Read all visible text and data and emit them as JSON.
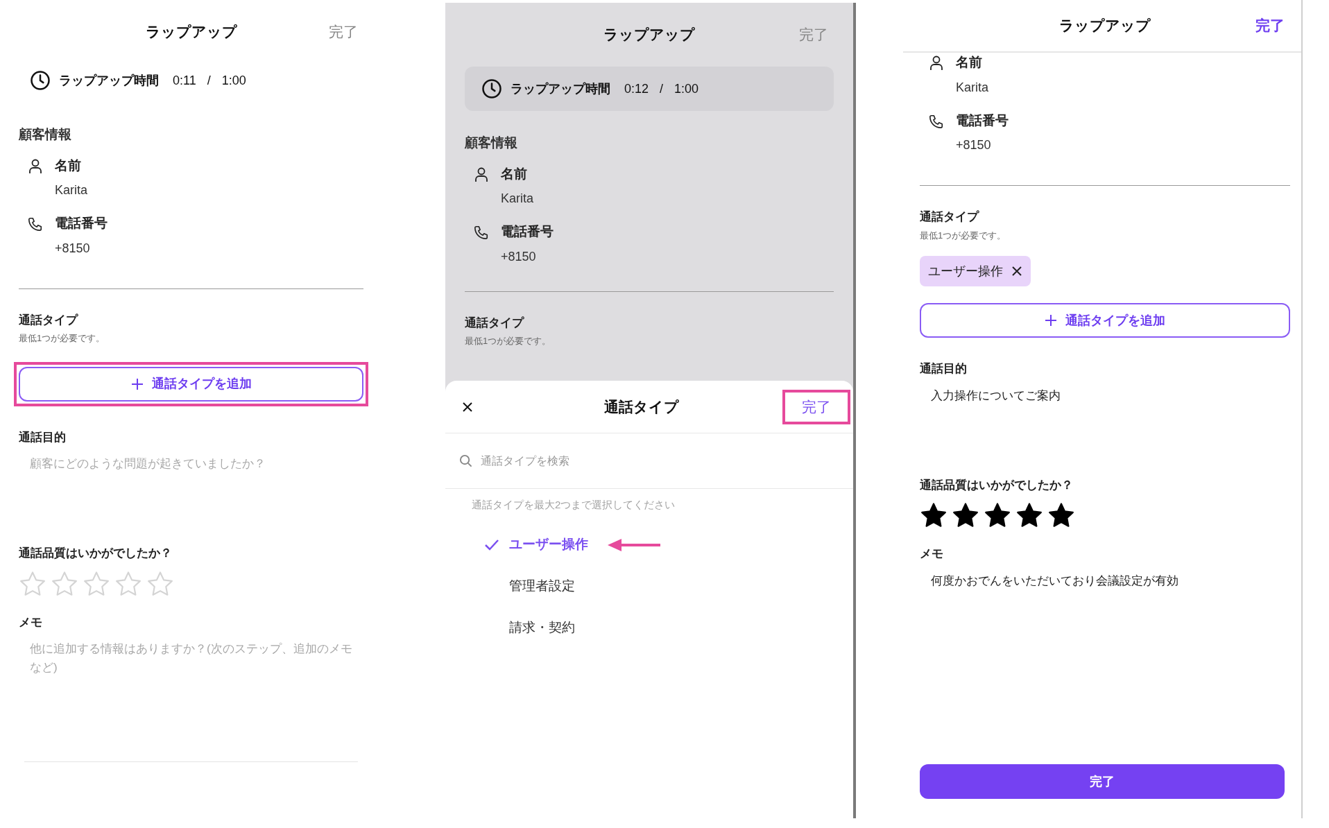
{
  "screens": [
    {
      "kind": "form",
      "header": {
        "title": "ラップアップ",
        "done": {
          "label": "完了",
          "enabled": false
        },
        "divider": false
      },
      "timer": {
        "label": "ラップアップ時間",
        "elapsed": "0:11",
        "separator": "/",
        "limit": "1:00",
        "boxed": false
      },
      "customer": {
        "heading": "顧客情報",
        "fields": [
          {
            "kind": "person",
            "label": "名前",
            "value": "Karita"
          },
          {
            "kind": "phone",
            "label": "電話番号",
            "value": "+8150"
          }
        ]
      },
      "call_type": {
        "label": "通話タイプ",
        "hint": "最低1つが必要です。",
        "add_button": {
          "label": "通話タイプを追加",
          "highlighted": true
        }
      },
      "purpose": {
        "label": "通話目的",
        "placeholder": "顧客にどのような問題が起きていましたか？"
      },
      "quality": {
        "label": "通話品質はいかがでしたか？",
        "stars": 0
      },
      "memo": {
        "label": "メモ",
        "placeholder": "他に追加する情報はありますか？(次のステップ、追加のメモなど)"
      }
    },
    {
      "kind": "sheet",
      "header": {
        "title": "ラップアップ",
        "done": {
          "label": "完了",
          "enabled": false
        },
        "divider": false
      },
      "timer": {
        "label": "ラップアップ時間",
        "elapsed": "0:12",
        "separator": "/",
        "limit": "1:00",
        "boxed": true
      },
      "customer": {
        "heading": "顧客情報",
        "fields": [
          {
            "kind": "person",
            "label": "名前",
            "value": "Karita"
          },
          {
            "kind": "phone",
            "label": "電話番号",
            "value": "+8150"
          }
        ]
      },
      "call_type": {
        "label": "通話タイプ",
        "hint": "最低1つが必要です。"
      },
      "sheet": {
        "title": "通話タイプ",
        "done": {
          "label": "完了",
          "highlighted": true
        },
        "search": {
          "placeholder": "通話タイプを検索"
        },
        "hint": "通話タイプを最大2つまで選択してください",
        "options": [
          {
            "label": "ユーザー操作",
            "selected": true,
            "arrow": true
          },
          {
            "label": "管理者設定",
            "selected": false,
            "arrow": false
          },
          {
            "label": "請求・契約",
            "selected": false,
            "arrow": false
          }
        ]
      }
    },
    {
      "kind": "form",
      "header": {
        "title": "ラップアップ",
        "done": {
          "label": "完了",
          "enabled": true
        },
        "divider": true
      },
      "customer": {
        "fields": [
          {
            "kind": "person",
            "label": "名前",
            "value": "Karita"
          },
          {
            "kind": "phone",
            "label": "電話番号",
            "value": "+8150"
          }
        ]
      },
      "call_type": {
        "label": "通話タイプ",
        "hint": "最低1つが必要です。",
        "chips": [
          {
            "label": "ユーザー操作"
          }
        ],
        "add_button": {
          "label": "通話タイプを追加",
          "highlighted": false
        }
      },
      "purpose": {
        "label": "通話目的",
        "value": "入力操作についてご案内"
      },
      "quality": {
        "label": "通話品質はいかがでしたか？",
        "stars": 5
      },
      "memo": {
        "label": "メモ",
        "value": "何度かおでんをいただいており会議設定が有効"
      },
      "footer_button": {
        "label": "完了"
      }
    }
  ]
}
